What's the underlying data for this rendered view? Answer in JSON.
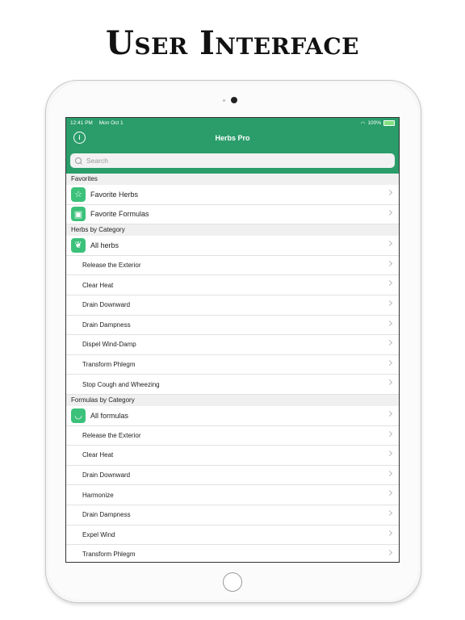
{
  "headline": "User Interface",
  "status_bar": {
    "time": "12:41 PM",
    "date": "Mon Oct 1",
    "battery": "100%"
  },
  "nav": {
    "title": "Herbs Pro"
  },
  "search": {
    "placeholder": "Search"
  },
  "favorites": {
    "header": "Favorites",
    "items": [
      {
        "label": "Favorite Herbs",
        "icon": "star-icon"
      },
      {
        "label": "Favorite Formulas",
        "icon": "calendar-star-icon"
      }
    ]
  },
  "herbs": {
    "header": "Herbs by Category",
    "all_label": "All herbs",
    "items": [
      "Release the Exterior",
      "Clear Heat",
      "Drain Downward",
      "Drain Dampness",
      "Dispel Wind-Damp",
      "Transform Phlegm",
      "Stop Cough and Wheezing"
    ]
  },
  "formulas": {
    "header": "Formulas by Category",
    "all_label": "All formulas",
    "items": [
      "Release the Exterior",
      "Clear Heat",
      "Drain Downward",
      "Harmonize",
      "Drain Dampness",
      "Expel Wind",
      "Transform Phlegm"
    ]
  },
  "colors": {
    "accent": "#2a9d6a",
    "icon_bg": "#3cc17a"
  }
}
